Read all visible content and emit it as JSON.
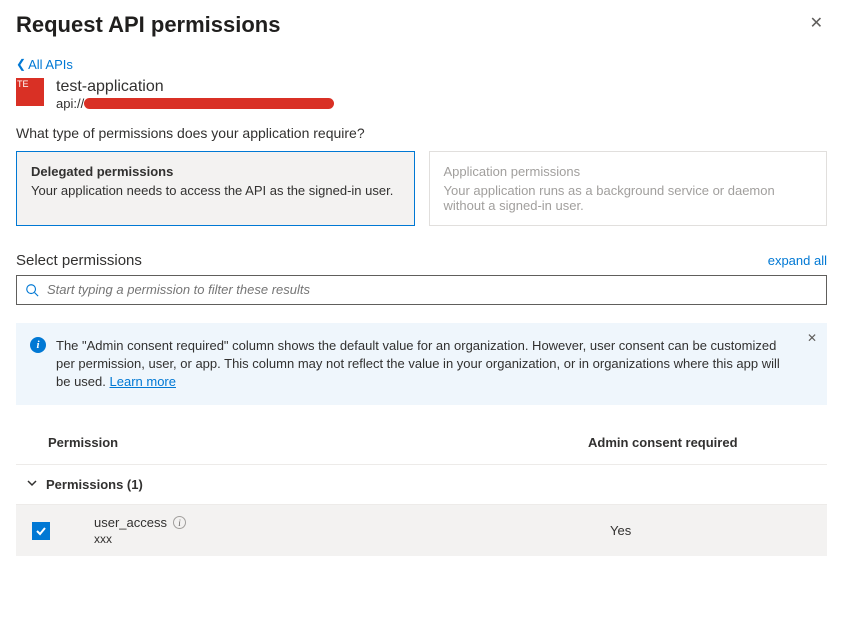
{
  "header": {
    "title": "Request API permissions",
    "back_link": "All APIs"
  },
  "app": {
    "badge": "TE",
    "name": "test-application",
    "uri_prefix": "api://"
  },
  "prompt": "What type of permissions does your application require?",
  "perm_types": {
    "delegated": {
      "title": "Delegated permissions",
      "desc": "Your application needs to access the API as the signed-in user."
    },
    "application": {
      "title": "Application permissions",
      "desc": "Your application runs as a background service or daemon without a signed-in user."
    }
  },
  "select": {
    "label": "Select permissions",
    "expand": "expand all",
    "search_placeholder": "Start typing a permission to filter these results"
  },
  "info": {
    "text": "The \"Admin consent required\" column shows the default value for an organization. However, user consent can be customized per permission, user, or app. This column may not reflect the value in your organization, or in organizations where this app will be used.  ",
    "link": "Learn more"
  },
  "table": {
    "col_permission": "Permission",
    "col_admin": "Admin consent required",
    "group_label": "Permissions (1)",
    "item": {
      "name": "user_access",
      "desc": "xxx",
      "admin_required": "Yes"
    }
  }
}
